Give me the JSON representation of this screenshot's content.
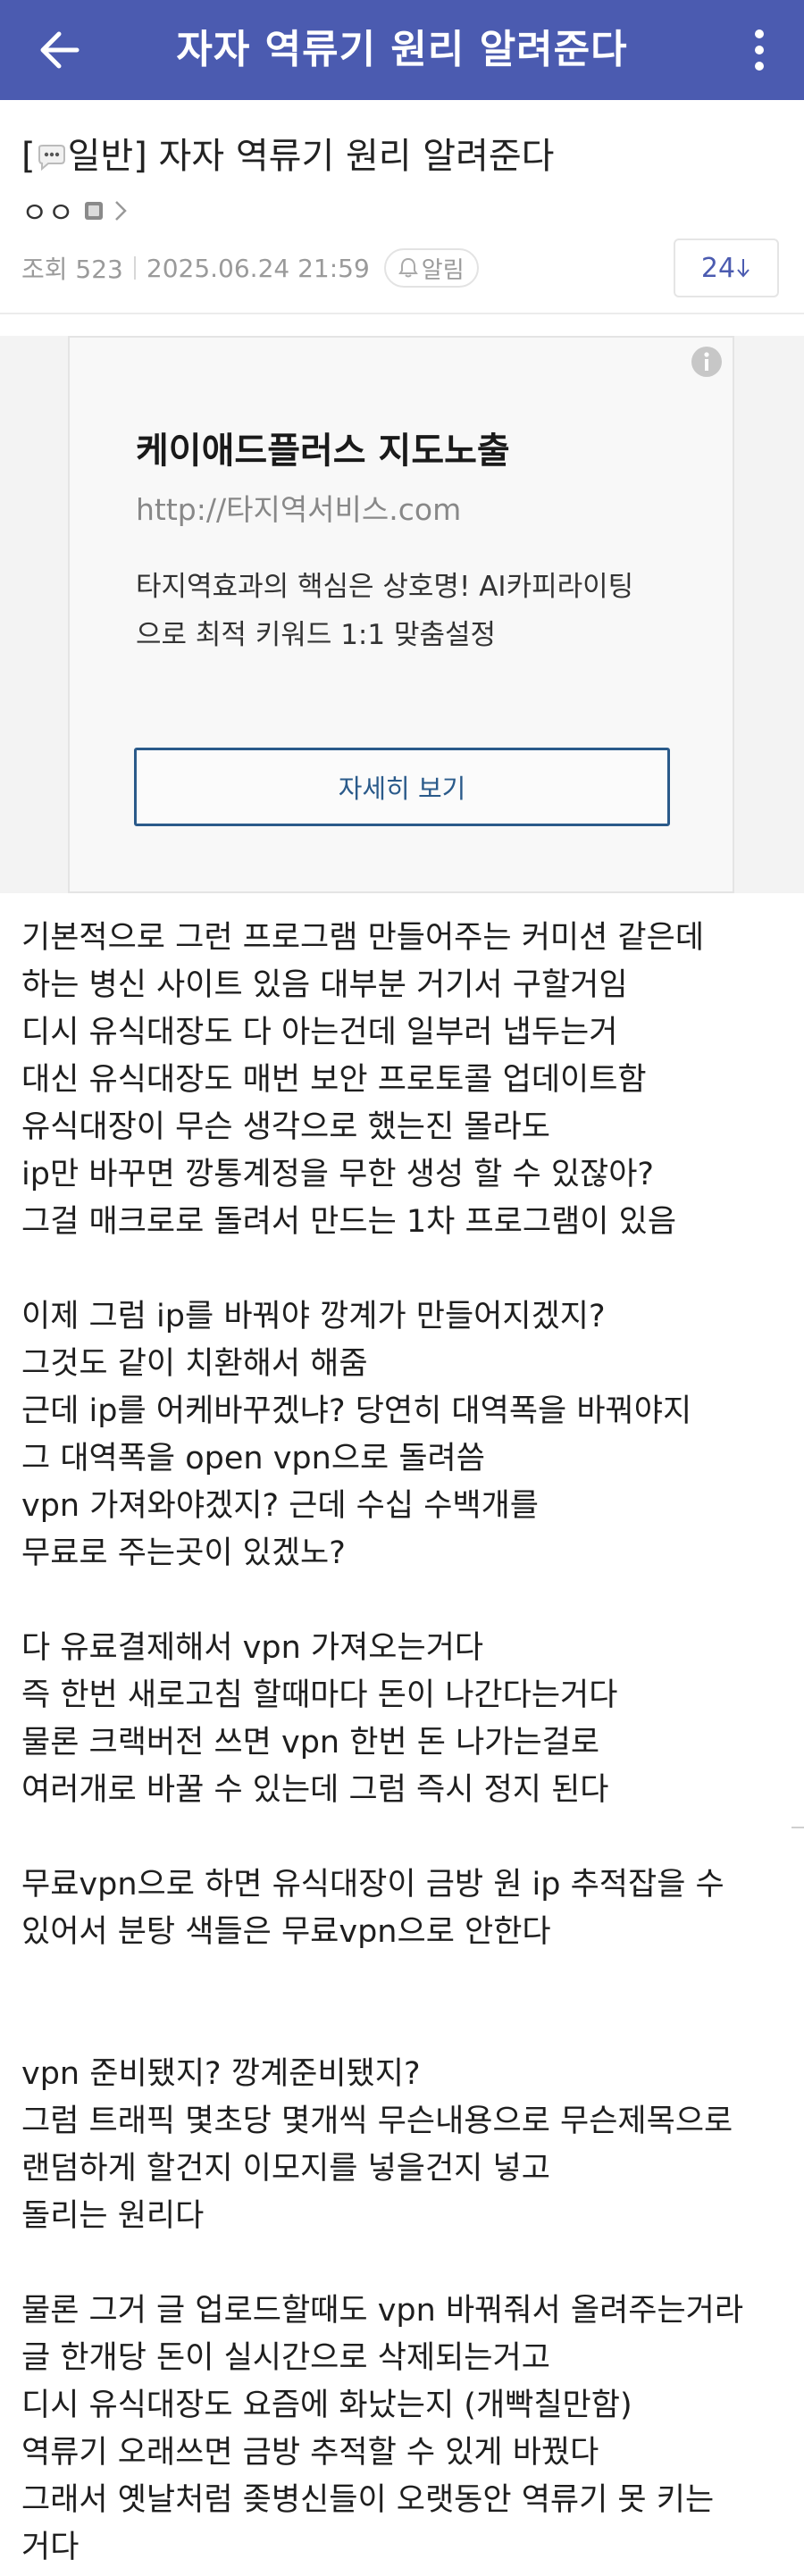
{
  "topbar": {
    "title": "자자 역류기 원리 알려준다"
  },
  "post": {
    "category_open": "[",
    "category": "일반]",
    "title": " 자자 역류기 원리 알려준다",
    "author": "ㅇㅇ",
    "views_label": "조회 523",
    "datetime": "2025.06.24 21:59",
    "alarm_label": "알림",
    "comment_count": "24"
  },
  "ad": {
    "title": "케이애드플러스 지도노출",
    "url": "http://타지역서비스.com",
    "desc_lines": [
      "타지역효과의 핵심은 상호명! AI카피라이팅",
      "으로 최적 키워드 1:1 맞춤설정"
    ],
    "cta": "자세히 보기"
  },
  "body": {
    "lines": [
      "기본적으로 그런 프로그램 만들어주는 커미션 같은데",
      "하는 병신 사이트 있음 대부분 거기서 구할거임",
      "디시 유식대장도 다 아는건데 일부러 냅두는거",
      "대신 유식대장도 매번 보안 프로토콜 업데이트함",
      "유식대장이 무슨 생각으로 했는진 몰라도",
      "ip만 바꾸면 깡통계정을 무한 생성 할 수 있잖아?",
      "그걸 매크로로 돌려서 만드는 1차 프로그램이 있음",
      "",
      "이제 그럼 ip를 바꿔야 깡계가 만들어지겠지?",
      "그것도 같이 치환해서 해줌",
      "근데 ip를 어케바꾸겠냐? 당연히 대역폭을 바꿔야지",
      "그 대역폭을 open vpn으로 돌려씀",
      "vpn 가져와야겠지? 근데 수십 수백개를",
      "무료로 주는곳이 있겠노?",
      "",
      "다 유료결제해서 vpn 가져오는거다",
      "즉 한번 새로고침 할때마다 돈이 나간다는거다",
      "물론 크랙버전 쓰면 vpn 한번 돈 나가는걸로",
      "여러개로 바꿀 수 있는데 그럼 즉시 정지 된다",
      "",
      "무료vpn으로 하면 유식대장이 금방 원 ip 추적잡을 수",
      "있어서 분탕 색들은 무료vpn으로 안한다",
      "",
      "",
      "vpn 준비됐지? 깡계준비됐지?",
      "그럼 트래픽 몇초당 몇개씩 무슨내용으로 무슨제목으로",
      "랜덤하게 할건지 이모지를 넣을건지 넣고",
      "돌리는 원리다",
      "",
      "물론 그거 글 업로드할때도 vpn 바꿔줘서 올려주는거라",
      "글 한개당 돈이 실시간으로 삭제되는거고",
      "디시 유식대장도 요즘에 화났는지 (개빡칠만함)",
      "역류기 오래쓰면 금방 추적할 수 있게 바꿨다",
      "그래서 옛날처럼 좆병신들이 오랫동안 역류기 못 키는",
      "거다"
    ]
  },
  "colors": {
    "topbar": "#4b5bb0",
    "accent": "#4b5bb0",
    "ad_button": "#2a5a8a"
  },
  "icons": {
    "back": "arrow-left-icon",
    "more": "more-vertical-icon",
    "category": "chat-bubble-icon",
    "author_badge": "user-badge-icon",
    "author_chevron": "chevron-right-icon",
    "alarm": "bell-icon",
    "comment_sort": "arrow-down-icon",
    "ad_info": "info-icon"
  }
}
